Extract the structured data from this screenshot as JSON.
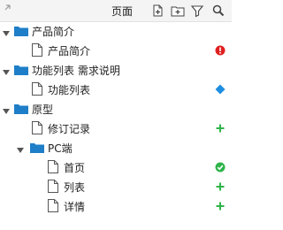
{
  "header": {
    "title": "页面",
    "tools": [
      "add-page-icon",
      "add-folder-icon",
      "filter-icon",
      "search-icon"
    ]
  },
  "colors": {
    "folder": "#1e7ec8",
    "error": "#e02020",
    "diamond": "#1e8ee0",
    "ok": "#2fb44a",
    "add": "#2fb44a"
  },
  "tree": {
    "folder_product": {
      "label": "产品简介"
    },
    "page_product": {
      "label": "产品简介",
      "status": "error-icon"
    },
    "folder_features": {
      "label": "功能列表 需求说明"
    },
    "page_features": {
      "label": "功能列表",
      "status": "diamond-icon"
    },
    "folder_prototype": {
      "label": "原型"
    },
    "page_changelog": {
      "label": "修订记录",
      "status": "add-icon"
    },
    "folder_pc": {
      "label": "PC端"
    },
    "page_home": {
      "label": "首页",
      "status": "check-icon"
    },
    "page_list": {
      "label": "列表",
      "status": "add-icon"
    },
    "page_detail": {
      "label": "详情",
      "status": "add-icon"
    }
  }
}
